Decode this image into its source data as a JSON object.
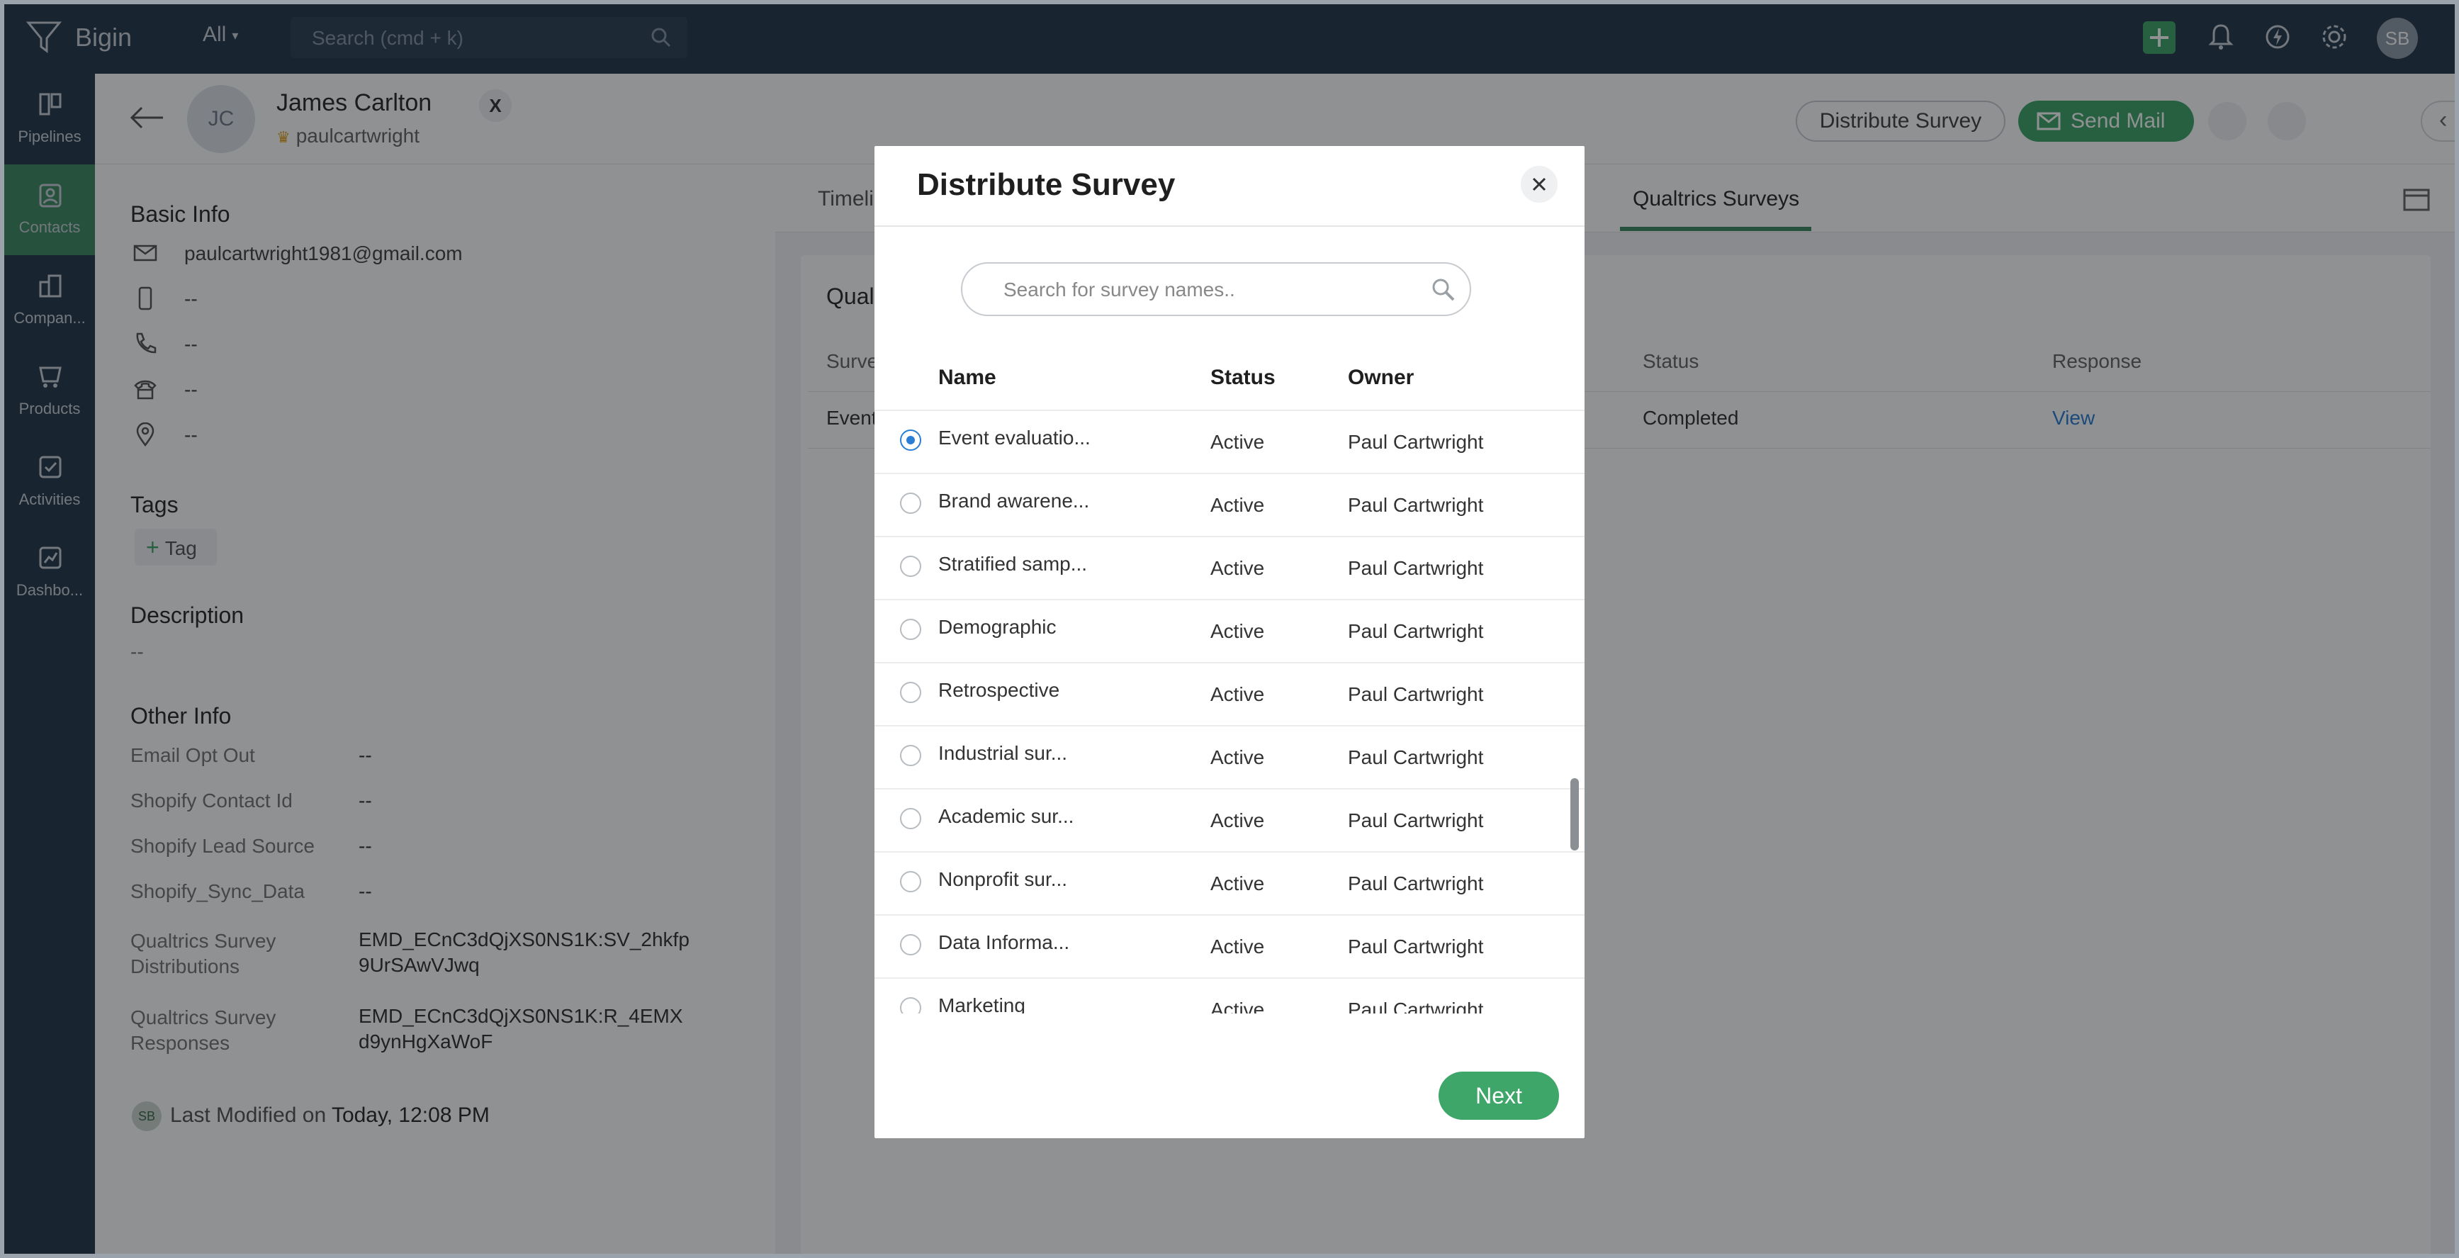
{
  "topbar": {
    "brand": "Bigin",
    "scope": "All",
    "search_placeholder": "Search (cmd + k)",
    "avatar_initials": "SB"
  },
  "sidebar": {
    "items": [
      {
        "label": "Pipelines",
        "icon": "pipelines-icon"
      },
      {
        "label": "Contacts",
        "icon": "contacts-icon",
        "active": true
      },
      {
        "label": "Compan...",
        "icon": "companies-icon"
      },
      {
        "label": "Products",
        "icon": "products-icon"
      },
      {
        "label": "Activities",
        "icon": "activities-icon"
      },
      {
        "label": "Dashbo...",
        "icon": "dashboards-icon"
      }
    ]
  },
  "contact": {
    "initials": "JC",
    "name": "James Carlton",
    "handle": "paulcartwright",
    "x_badge": "X",
    "distribute_label": "Distribute Survey",
    "send_mail_label": "Send Mail"
  },
  "details": {
    "basic_info_title": "Basic Info",
    "email": "paulcartwright1981@gmail.com",
    "mobile": "--",
    "phone": "--",
    "home_phone": "--",
    "address": "--",
    "tags_title": "Tags",
    "tag_button": "Tag",
    "description_title": "Description",
    "description_value": "--",
    "other_info_title": "Other Info",
    "fields": [
      {
        "label": "Email Opt Out",
        "value": "--"
      },
      {
        "label": "Shopify Contact Id",
        "value": "--"
      },
      {
        "label": "Shopify Lead Source",
        "value": "--"
      },
      {
        "label": "Shopify_Sync_Data",
        "value": "--"
      },
      {
        "label1": "Qualtrics Survey",
        "label2": "Distributions",
        "value1": "EMD_ECnC3dQjXS0NS1K:SV_2hkfp",
        "value2": "9UrSAwVJwq"
      },
      {
        "label1": "Qualtrics Survey",
        "label2": "Responses",
        "value1": "EMD_ECnC3dQjXS0NS1K:R_4EMX",
        "value2": "d9ynHgXaWoF"
      }
    ],
    "modified_initials": "SB",
    "modified_prefix": "Last Modified on",
    "modified_value": "Today, 12:08 PM"
  },
  "tabs": {
    "timeline": "Timeli",
    "qualtrics": "Qualtrics Surveys"
  },
  "survey_table": {
    "title": "Qual",
    "col_survey": "Surve",
    "col_status": "Status",
    "col_response": "Response",
    "row_survey": "Event",
    "row_status": "Completed",
    "row_response": "View"
  },
  "modal": {
    "title": "Distribute Survey",
    "search_placeholder": "Search for survey names..",
    "col_name": "Name",
    "col_status": "Status",
    "col_owner": "Owner",
    "rows": [
      {
        "name": "Event evaluatio...",
        "status": "Active",
        "owner": "Paul Cartwright",
        "selected": true
      },
      {
        "name": "Brand awarene...",
        "status": "Active",
        "owner": "Paul Cartwright"
      },
      {
        "name": "Stratified samp...",
        "status": "Active",
        "owner": "Paul Cartwright"
      },
      {
        "name": "Demographic",
        "status": "Active",
        "owner": "Paul Cartwright"
      },
      {
        "name": "Retrospective",
        "status": "Active",
        "owner": "Paul Cartwright"
      },
      {
        "name": "Industrial sur...",
        "status": "Active",
        "owner": "Paul Cartwright"
      },
      {
        "name": "Academic sur...",
        "status": "Active",
        "owner": "Paul Cartwright"
      },
      {
        "name": "Nonprofit sur...",
        "status": "Active",
        "owner": "Paul Cartwright"
      },
      {
        "name": "Data Informa...",
        "status": "Active",
        "owner": "Paul Cartwright"
      },
      {
        "name": "Marketing",
        "status": "Active",
        "owner": "Paul Cartwright"
      }
    ],
    "next_label": "Next"
  },
  "colors": {
    "topbar": "#26394a",
    "accent_green": "#3fa66a",
    "link_blue": "#2a7fd4"
  }
}
